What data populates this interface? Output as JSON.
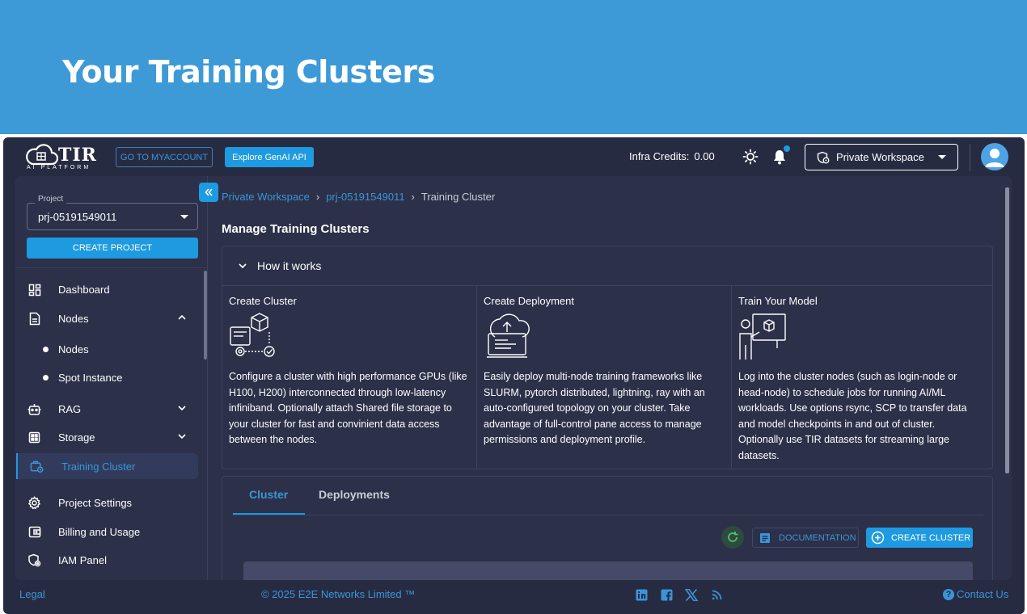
{
  "banner": {
    "title": "Your Training Clusters"
  },
  "topbar": {
    "logo_text": "TIR",
    "logo_sub": "AI PLATFORM",
    "go_myaccount": "GO TO MYACCOUNT",
    "explore_genai": "Explore GenAI API",
    "credits_label": "Infra Credits:",
    "credits_value": "0.00",
    "workspace": "Private Workspace",
    "icons": [
      "sun-icon",
      "bell-icon",
      "workspace-icon",
      "avatar-icon"
    ]
  },
  "sidebar": {
    "project_label": "Project",
    "project_value": "prj-05191549011",
    "create_project": "CREATE PROJECT",
    "items": {
      "dashboard": "Dashboard",
      "nodes": "Nodes",
      "nodes_sub": "Nodes",
      "spot_instance": "Spot Instance",
      "rag": "RAG",
      "storage": "Storage",
      "training_cluster": "Training Cluster",
      "project_settings": "Project Settings",
      "billing": "Billing and Usage",
      "iam": "IAM Panel"
    }
  },
  "breadcrumb": {
    "workspace": "Private Workspace",
    "project": "prj-05191549011",
    "current": "Training Cluster",
    "separator": "›"
  },
  "main": {
    "title": "Manage Training Clusters",
    "how_it_works": "How it works",
    "steps": [
      {
        "title": "Create Cluster",
        "text": "Configure a cluster with high performance GPUs (like H100, H200) interconnected through low-latency infiniband. Optionally attach Shared file storage to your cluster for fast and convinient data access between the nodes."
      },
      {
        "title": "Create Deployment",
        "text": "Easily deploy multi-node training frameworks like SLURM, pytorch distributed, lightning, ray with an auto-configured topology on your cluster. Take advantage of full-control pane access to manage permissions and deployment profile."
      },
      {
        "title": "Train Your Model",
        "text": "Log into the cluster nodes (such as login-node or head-node) to schedule jobs for running AI/ML workloads. Use options rsync, SCP to transfer data and model checkpoints in and out of cluster. Optionally use TIR datasets for streaming large datasets."
      }
    ],
    "tabs": {
      "cluster": "Cluster",
      "deployments": "Deployments"
    },
    "documentation": "DOCUMENTATION",
    "create_cluster": "CREATE CLUSTER"
  },
  "footer": {
    "legal": "Legal",
    "copyright": "© 2025 E2E Networks Limited ™",
    "social": [
      "linkedin-icon",
      "facebook-icon",
      "x-icon",
      "rss-icon"
    ],
    "contact": "Contact Us"
  },
  "colors": {
    "banner": "#3d9ad6",
    "app_bg": "#272b42",
    "panel_bg": "#2c3049",
    "accent": "#1e9ae0",
    "link": "#3a95d8"
  }
}
